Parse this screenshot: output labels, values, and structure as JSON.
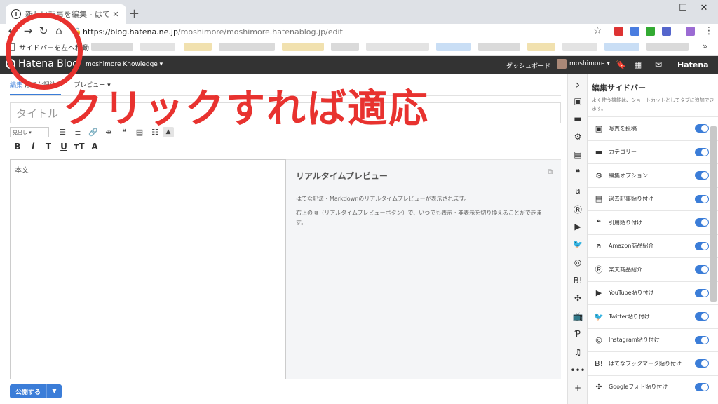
{
  "browser": {
    "tab_title": "新しい記事を編集 - はてなブログ",
    "tab_close": "✕",
    "new_tab": "+",
    "url_host": "https://blog.hatena.ne.jp",
    "url_path": "/moshimore/moshimore.hatenablog.jp/edit",
    "bookmark_first": "サイドバーを左へ移動",
    "bookmark_more": "»"
  },
  "hatena_bar": {
    "logo": "Hatena Blog",
    "blog_name": "moshimore Knowledge ▾",
    "dashboard": "ダッシュボード",
    "user": "moshimore ▾",
    "brand": "Hatena"
  },
  "editor": {
    "tab_edit": "編集",
    "tab_edit_mode": "はてな記法 ▾",
    "tab_preview": "プレビュー ▾",
    "title_placeholder": "タイトル",
    "heading_select": "見出し",
    "body_placeholder": "本文",
    "preview_title": "リアルタイムプレビュー",
    "preview_text_1": "はてな記法・Markdownのリアルタイムプレビューが表示されます。",
    "preview_text_2": "右上の ⧉（リアルタイムプレビューボタン）で、いつでも表示・非表示を切り換えることができます。",
    "publish_label": "公開する",
    "publish_dropdown": "▼"
  },
  "sidebar": {
    "title": "編集サイドバー",
    "description": "よく使う機能は、ショートカットとしてタブに追加できます。",
    "items": [
      {
        "label": "写真を投稿",
        "icon": "▣",
        "enabled": true
      },
      {
        "label": "カテゴリー",
        "icon": "▬",
        "enabled": true
      },
      {
        "label": "編集オプション",
        "icon": "⚙",
        "enabled": true
      },
      {
        "label": "過去記事貼り付け",
        "icon": "▤",
        "enabled": true
      },
      {
        "label": "引用貼り付け",
        "icon": "❝",
        "enabled": true
      },
      {
        "label": "Amazon商品紹介",
        "icon": "a",
        "enabled": true
      },
      {
        "label": "楽天商品紹介",
        "icon": "Ⓡ",
        "enabled": true
      },
      {
        "label": "YouTube貼り付け",
        "icon": "▶",
        "enabled": true
      },
      {
        "label": "Twitter貼り付け",
        "icon": "🐦",
        "enabled": true
      },
      {
        "label": "Instagram貼り付け",
        "icon": "◎",
        "enabled": true
      },
      {
        "label": "はてなブックマーク貼り付け",
        "icon": "B!",
        "enabled": true
      },
      {
        "label": "Googleフォト貼り付け",
        "icon": "✣",
        "enabled": true
      }
    ]
  },
  "rail_icons": [
    "›",
    "▣",
    "▬",
    "⚙",
    "▤",
    "❝",
    "a",
    "Ⓡ",
    "▶",
    "🐦",
    "◎",
    "B!",
    "✣",
    "📺",
    "Ƥ",
    "♫",
    "•••",
    "+"
  ],
  "annotation": {
    "text": "クリックすれば適応"
  },
  "colors": {
    "accent": "#3b7dd8",
    "annotation": "#e8322f",
    "hatena_bar": "#333333"
  }
}
